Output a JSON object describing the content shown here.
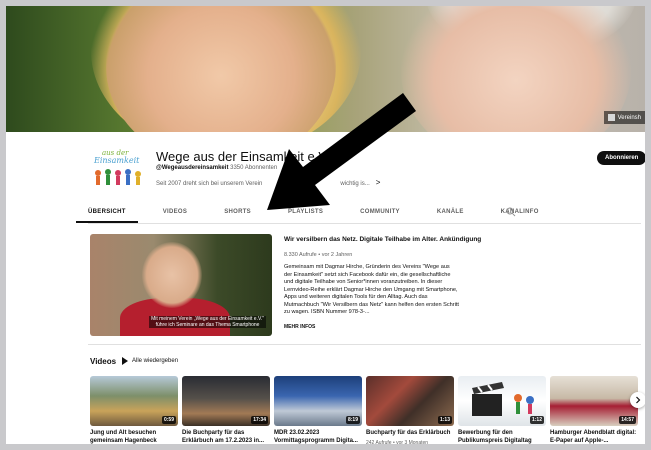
{
  "banner": {
    "link_label": "Vereinsh"
  },
  "channel": {
    "title": "Wege aus der Einsamkeit e.V.",
    "handle": "@Wegeausdereinsamkeit",
    "subscribers": "3350 Abonnenten",
    "desc_start": "Seit 2007 dreht sich bei unserem Verein",
    "desc_end": "wichtig is...",
    "subscribe_label": "Abonnieren"
  },
  "tabs": [
    "ÜBERSICHT",
    "VIDEOS",
    "SHORTS",
    "PLAYLISTS",
    "COMMUNITY",
    "KANÄLE",
    "KANALINFO"
  ],
  "featured": {
    "title": "Wir versilbern das Netz. Digitale Teilhabe im Alter. Ankündigung",
    "stats": "8.330 Aufrufe • vor 2 Jahren",
    "description": "Gemeinsam mit Dagmar Hirche, Gründerin des Vereins \"Wege aus der Einsamkeit\" setzt sich Facebook dafür ein, die gesellschaftliche und digitale Teilhabe von Senior*innen voranzutreiben. In dieser Lernvideo-Reihe erklärt Dagmar Hirche den Umgang mit Smartphone, Apps und weiteren digitalen Tools für den Alltag. Auch das Mutmachbuch \"Wir Versilbern das Netz\" kann helfen den ersten Schritt zu wagen. ISBN Nummer 978-3-...",
    "more": "MEHR INFOS",
    "caption_line1": "Mit meinem Verein „Wege aus der Einsamkeit e.V.\"",
    "caption_line2": "führe ich Seminare an das Thema Smartphone"
  },
  "videos_section": {
    "heading": "Videos",
    "play_all": "Alle wiedergeben"
  },
  "videos": [
    {
      "title": "Jung und Alt besuchen gemeinsam Hagenbeck",
      "stats": "",
      "duration": "0:59"
    },
    {
      "title": "Die Buchparty für das Erklärbuch am 17.2.2023 in...",
      "stats": "",
      "duration": "17:34"
    },
    {
      "title": "MDR 23.02.2023 Vormittagsprogramm Digita...",
      "stats": "",
      "duration": "8:19"
    },
    {
      "title": "Buchparty für das Erklärbuch",
      "stats": "242 Aufrufe • vor 3 Monaten",
      "duration": "1:13"
    },
    {
      "title": "Bewerbung für den Publikumspreis Digitaltag",
      "stats": "",
      "duration": "1:12"
    },
    {
      "title": "Hamburger Abendblatt digital: E-Paper auf Apple-...",
      "stats": "",
      "duration": "14:57"
    }
  ],
  "colors": {
    "subscribe_bg": "#0f0f0f",
    "active_tab_underline": "#0f0f0f",
    "annotation_arrow": "#000000"
  }
}
